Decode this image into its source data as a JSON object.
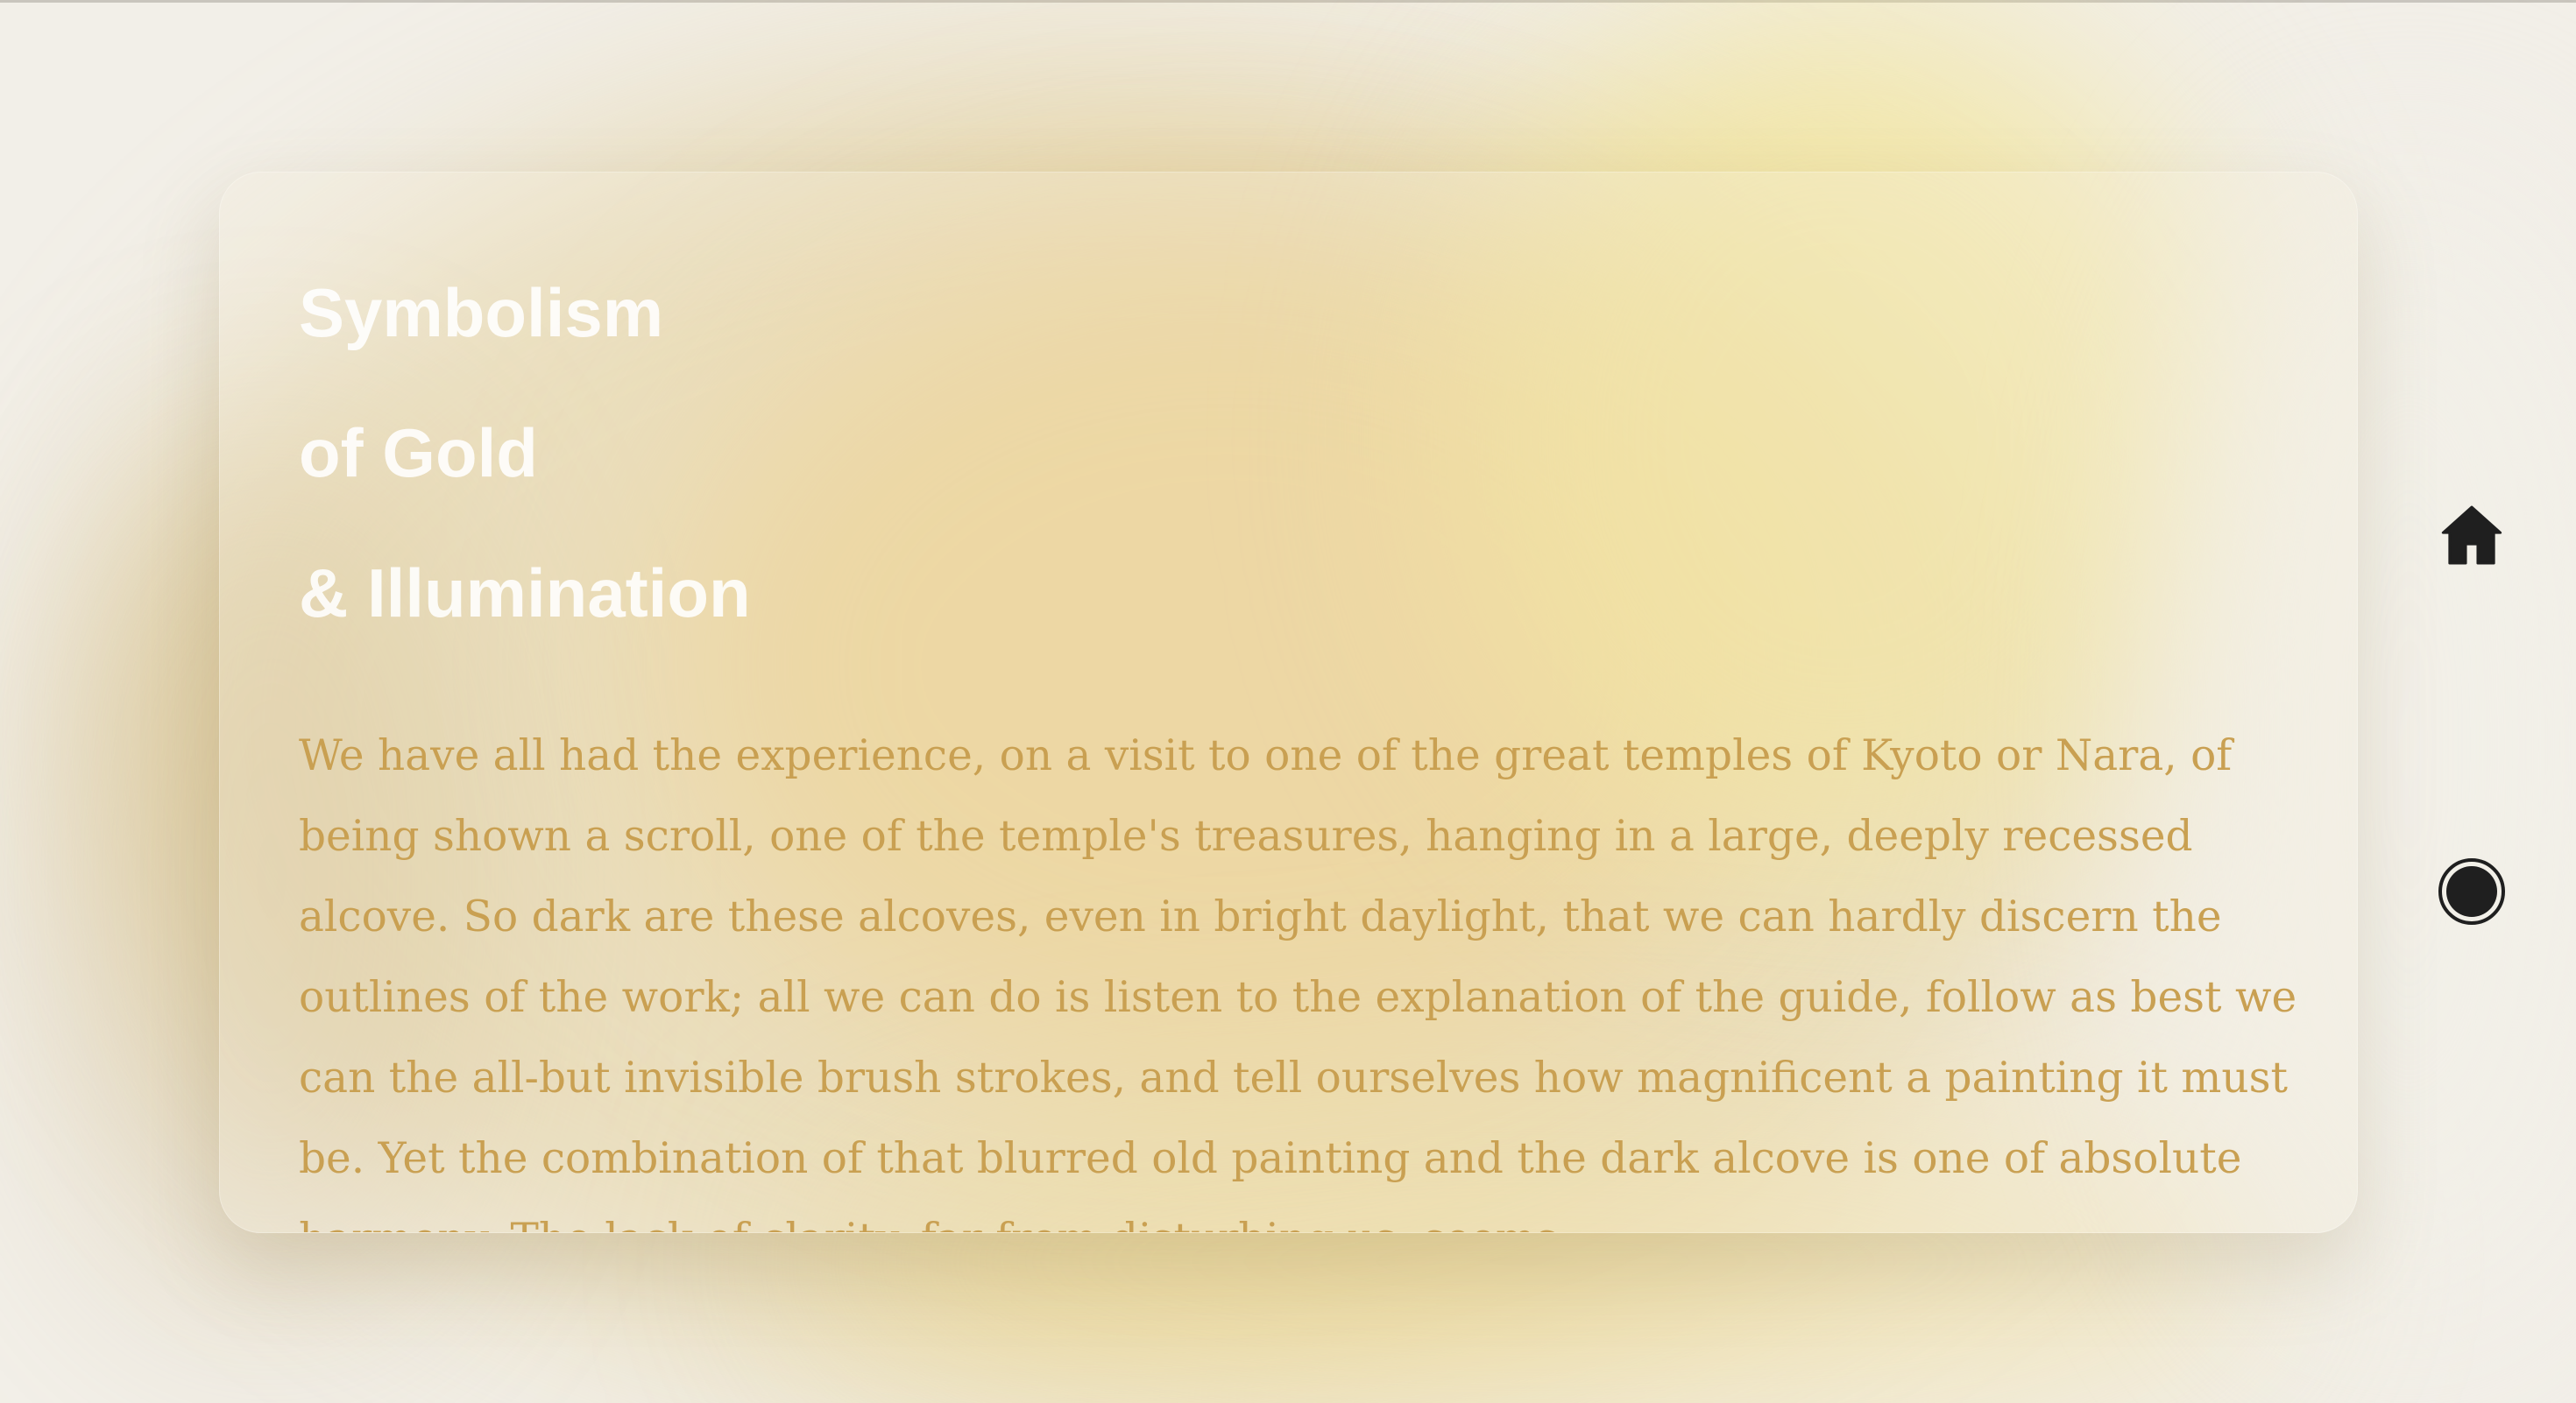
{
  "card": {
    "title_lines": [
      "Symbolism",
      "of Gold",
      "& Illumination"
    ],
    "body": "We have all had the experience, on a visit to one of the great temples of Kyoto or Nara, of being shown a scroll, one of the temple's treasures, hanging in a large, deeply recessed alcove. So dark are these alcoves, even in bright daylight, that we can hardly discern the outlines of the work; all we can do is listen to the explanation of the guide, follow as best we can the all-but invisible brush strokes, and tell ourselves how magnificent a painting it must be. Yet the combination of that blurred old painting and the dark alcove is one of absolute harmony. The lack of clarity, far from disturbing us, seems"
  },
  "nav": {
    "items": [
      {
        "icon": "home-icon"
      },
      {
        "icon": "circle-dot-icon"
      }
    ]
  },
  "colors": {
    "background": "#f2efe8",
    "accent_gold": "#c9a052",
    "title_white": "#ffffff",
    "icon_dark": "#1f1f1f"
  }
}
